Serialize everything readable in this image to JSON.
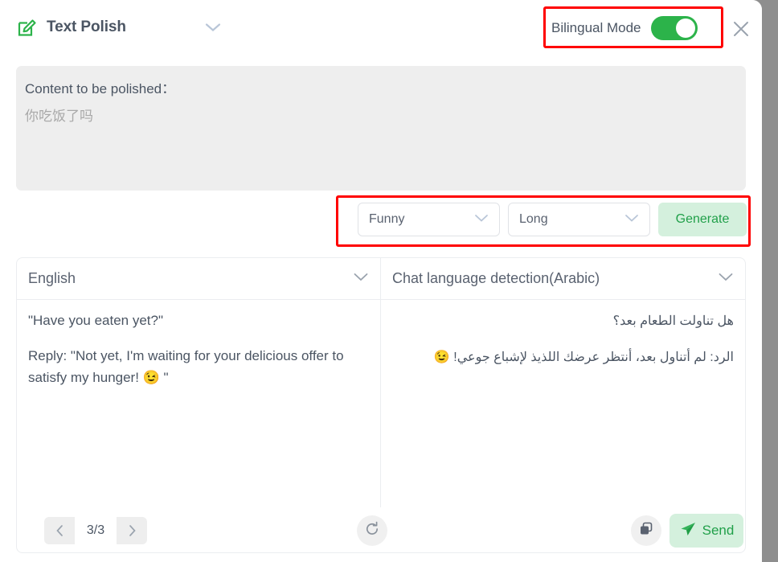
{
  "window": {
    "title": "Text Polish",
    "title_icon": "edit-square-icon",
    "expand_icon": "chevron-down-icon",
    "close_icon": "close-icon"
  },
  "bilingual": {
    "label": "Bilingual Mode",
    "state": "on",
    "highlight_color": "#ff0000",
    "toggle_color": "#2cb34a"
  },
  "input": {
    "label": "Content to be polished：",
    "value": "你吃饭了吗"
  },
  "controls": {
    "tone": {
      "value": "Funny",
      "icon": "chevron-down-icon"
    },
    "length": {
      "value": "Long",
      "icon": "chevron-down-icon"
    },
    "generate_label": "Generate",
    "generate_color": "#21a04a",
    "highlight_color": "#ff0000"
  },
  "panes": [
    {
      "name": "english",
      "header": "English",
      "header_icon": "chevron-down-icon",
      "paragraphs": [
        "\"Have you eaten yet?\"",
        "Reply: \"Not yet, I'm waiting for your delicious offer to satisfy my hunger! 😉 \""
      ]
    },
    {
      "name": "arabic",
      "header": "Chat language detection(Arabic)",
      "header_icon": "chevron-down-icon",
      "paragraphs": [
        "هل تناولت الطعام بعد؟",
        "الرد: لم أتناول بعد، أنتظر عرضك اللذيذ لإشباع جوعي! 😉"
      ]
    }
  ],
  "footer": {
    "prev_icon": "chevron-left-icon",
    "page_indicator": "3/3",
    "next_icon": "chevron-right-icon",
    "refresh_icon": "refresh-icon",
    "copy_icon": "copy-icon",
    "send_label": "Send",
    "send_icon": "paper-plane-icon"
  }
}
